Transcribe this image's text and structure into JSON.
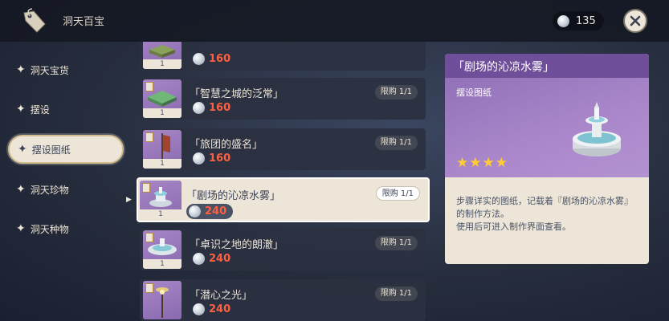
{
  "header": {
    "title": "洞天百宝",
    "currency_amount": "135"
  },
  "sidebar": {
    "items": [
      {
        "label": "洞天宝货"
      },
      {
        "label": "摆设"
      },
      {
        "label": "摆设图纸"
      },
      {
        "label": "洞天珍物"
      },
      {
        "label": "洞天种物"
      }
    ]
  },
  "items": [
    {
      "name": "",
      "price": "160",
      "count": "1",
      "limit": ""
    },
    {
      "name": "「智慧之城的泛常」",
      "price": "160",
      "count": "1",
      "limit": "限购 1/1"
    },
    {
      "name": "「旅团的盛名」",
      "price": "160",
      "count": "1",
      "limit": "限购 1/1"
    },
    {
      "name": "「剧场的沁凉水雾」",
      "price": "240",
      "count": "1",
      "limit": "限购 1/1"
    },
    {
      "name": "「卓识之地的朗澈」",
      "price": "240",
      "count": "1",
      "limit": "限购 1/1"
    },
    {
      "name": "「潜心之光」",
      "price": "240",
      "count": "1",
      "limit": "限购 1/1"
    }
  ],
  "detail": {
    "title": "「剧场的沁凉水雾」",
    "subtitle": "摆设图纸",
    "rating": "★★★★",
    "description": "步骤详实的图纸，记载着『剧场的沁凉水雾』的制作方法。\n使用后可进入制作界面查看。"
  },
  "colors": {
    "accent": "#d3bc8e",
    "price": "#ff5f40",
    "card_purple": "#8c6cb4"
  }
}
